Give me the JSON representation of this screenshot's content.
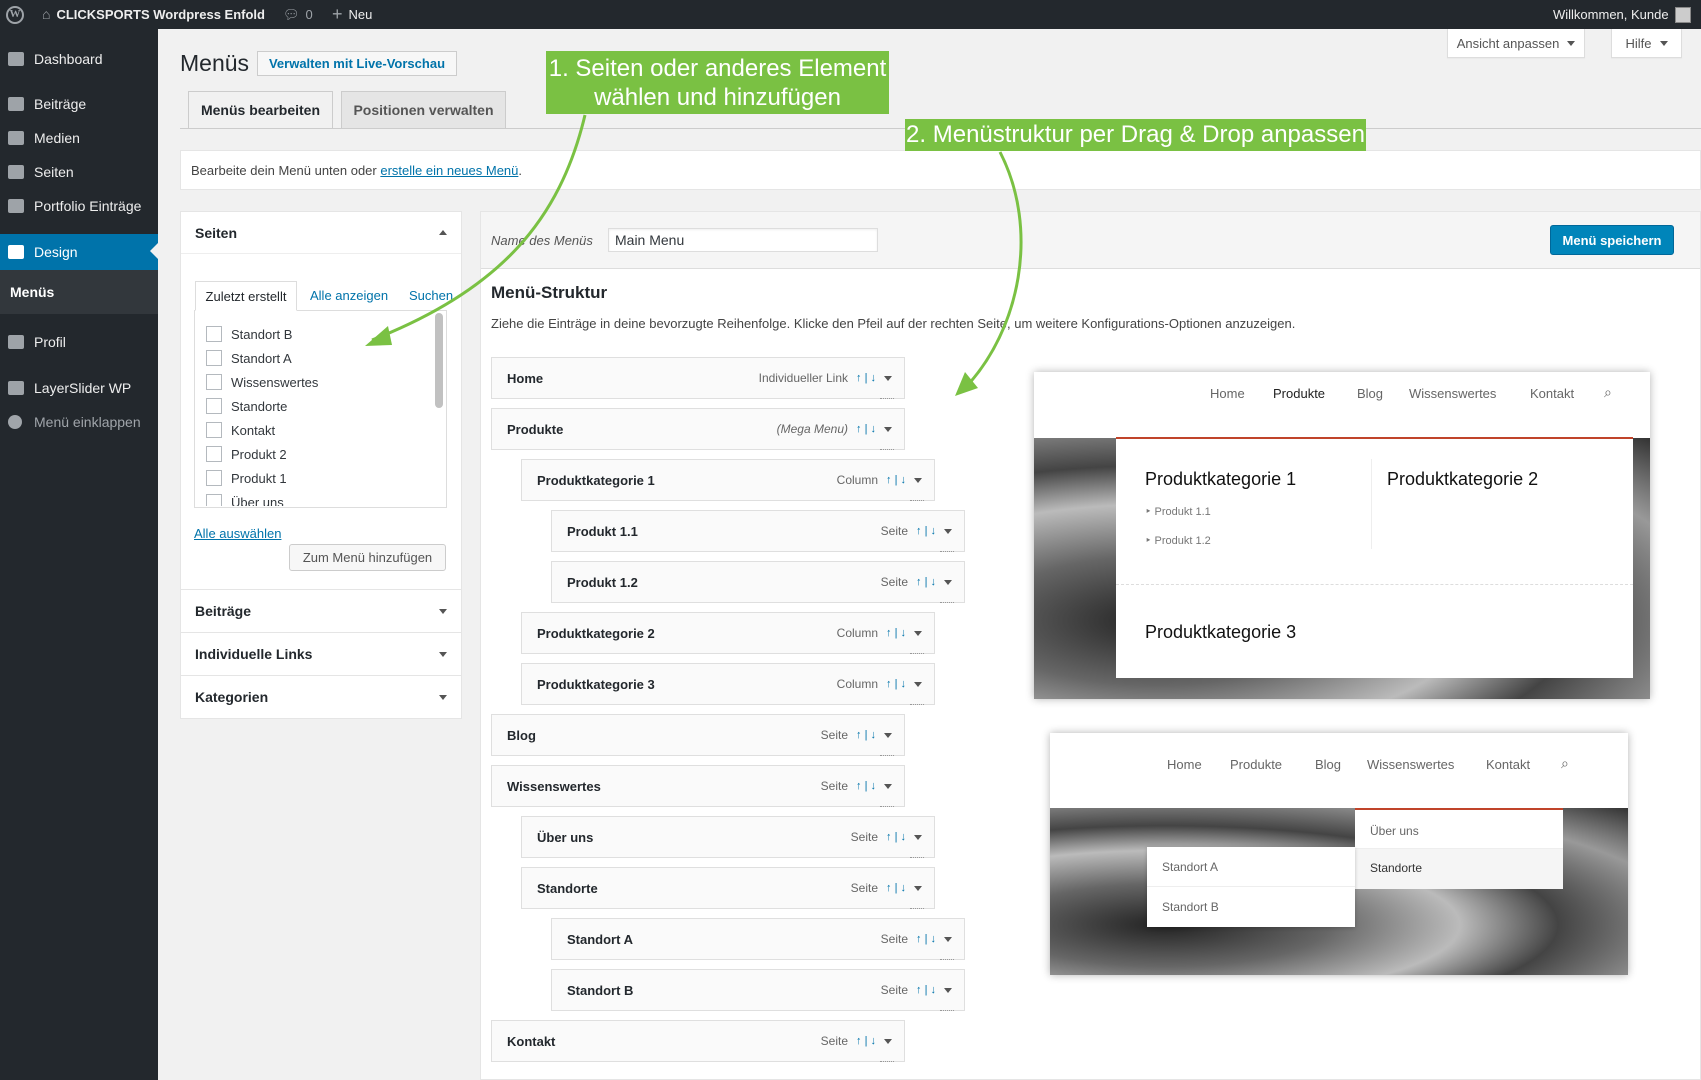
{
  "adminbar": {
    "site_name": "CLICKSPORTS Wordpress Enfold",
    "comments_count": "0",
    "new_label": "Neu",
    "greeting": "Willkommen, Kunde"
  },
  "sidebar": {
    "items": [
      "Dashboard",
      "Beiträge",
      "Medien",
      "Seiten",
      "Portfolio Einträge",
      "Design",
      "Menüs",
      "Profil",
      "LayerSlider WP",
      "Menü einklappen"
    ]
  },
  "screen_options": {
    "label": "Ansicht anpassen"
  },
  "help": {
    "label": "Hilfe"
  },
  "page": {
    "title": "Menüs",
    "live_preview_button": "Verwalten mit Live-Vorschau",
    "tabs": [
      "Menüs bearbeiten",
      "Positionen verwalten"
    ],
    "notice_text": "Bearbeite dein Menü unten oder ",
    "notice_link": "erstelle ein neues Menü",
    "notice_end": "."
  },
  "left_panel": {
    "pages_heading": "Seiten",
    "inner_tabs": [
      "Zuletzt erstellt",
      "Alle anzeigen",
      "Suchen"
    ],
    "pages": [
      "Standort B",
      "Standort A",
      "Wissenswertes",
      "Standorte",
      "Kontakt",
      "Produkt 2",
      "Produkt 1",
      "Über uns"
    ],
    "select_all": "Alle auswählen",
    "add_button": "Zum Menü hinzufügen",
    "sections": [
      "Beiträge",
      "Individuelle Links",
      "Kategorien"
    ]
  },
  "menu_editor": {
    "name_label": "Name des Menüs",
    "name_value": "Main Menu",
    "save_button": "Menü speichern",
    "structure_heading": "Menü-Struktur",
    "structure_hint": "Ziehe die Einträge in deine bevorzugte Reihenfolge. Klicke den Pfeil auf der rechten Seite, um weitere Konfigurations-Optionen anzuzeigen.",
    "arrows": "↑ | ↓",
    "items": [
      {
        "title": "Home",
        "type": "Individueller Link",
        "depth": 0
      },
      {
        "title": "Produkte",
        "type": "(Mega Menu)",
        "depth": 0
      },
      {
        "title": "Produktkategorie 1",
        "type": "Column",
        "depth": 1
      },
      {
        "title": "Produkt 1.1",
        "type": "Seite",
        "depth": 2
      },
      {
        "title": "Produkt 1.2",
        "type": "Seite",
        "depth": 2
      },
      {
        "title": "Produktkategorie 2",
        "type": "Column",
        "depth": 1
      },
      {
        "title": "Produktkategorie 3",
        "type": "Column",
        "depth": 1
      },
      {
        "title": "Blog",
        "type": "Seite",
        "depth": 0
      },
      {
        "title": "Wissenswertes",
        "type": "Seite",
        "depth": 0
      },
      {
        "title": "Über uns",
        "type": "Seite",
        "depth": 1
      },
      {
        "title": "Standorte",
        "type": "Seite",
        "depth": 1
      },
      {
        "title": "Standort A",
        "type": "Seite",
        "depth": 2
      },
      {
        "title": "Standort B",
        "type": "Seite",
        "depth": 2
      },
      {
        "title": "Kontakt",
        "type": "Seite",
        "depth": 0
      }
    ]
  },
  "callouts": {
    "step1_line1": "1. Seiten oder anderes Element",
    "step1_line2": "wählen und hinzufügen",
    "step2": "2. Menüstruktur per Drag & Drop anpassen"
  },
  "preview1": {
    "nav": [
      "Home",
      "Produkte",
      "Blog",
      "Wissenswertes",
      "Kontakt"
    ],
    "col1_title": "Produktkategorie 1",
    "col1_items": [
      "Produkt 1.1",
      "Produkt 1.2"
    ],
    "col2_title": "Produktkategorie 2",
    "col3_title": "Produktkategorie 3"
  },
  "preview2": {
    "nav": [
      "Home",
      "Produkte",
      "Blog",
      "Wissenswertes",
      "Kontakt"
    ],
    "dropdown": [
      "Über uns",
      "Standorte"
    ],
    "subdropdown": [
      "Standort A",
      "Standort B"
    ]
  },
  "colors": {
    "admin_dark": "#23282d",
    "wp_blue": "#0073aa",
    "callout_green": "#7ac143",
    "save_blue": "#0085ba",
    "preview_accent": "#c0442a"
  }
}
